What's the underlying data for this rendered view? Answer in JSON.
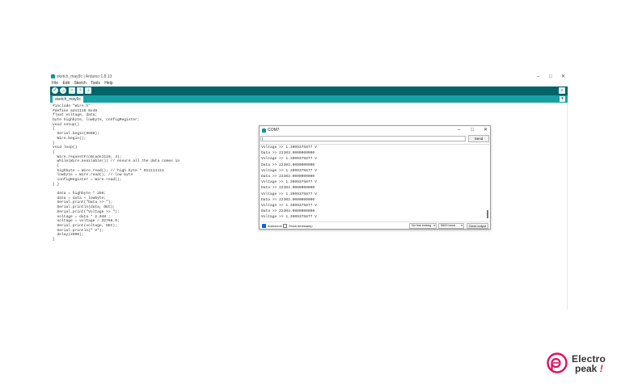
{
  "ide": {
    "title": "sketch_may9c | Arduino 1.8.13",
    "window_controls": [
      "–",
      "□",
      "✕"
    ],
    "menu": [
      "File",
      "Edit",
      "Sketch",
      "Tools",
      "Help"
    ],
    "toolbar_icons": [
      "verify-icon",
      "upload-icon",
      "new-icon",
      "open-icon",
      "save-icon"
    ],
    "tab_label": "sketch_may9c",
    "code_lines": [
      "#include \"Wire.h\"",
      "#define ads1110 0x48",
      "float voltage, data;",
      "byte highbyte, lowbyte, configRegister;",
      "void setup()",
      "{",
      "  Serial.begin(9600);",
      "  Wire.begin();",
      "}",
      "void loop()",
      "{",
      "  Wire.requestFrom(ads1110, 3);",
      "  while(Wire.available()) // ensure all the data comes in",
      "  {",
      "  highbyte = Wire.read(); // high byte * B11111111",
      "  lowbyte = Wire.read(); // low byte",
      "  configRegister = Wire.read();",
      "} }",
      "",
      "  data = highbyte * 256;",
      "  data = data + lowbyte;",
      "  Serial.print(\"Data >> \");",
      "  Serial.println(data, DEC);",
      "  Serial.print(\"Voltage >> \");",
      "  voltage = data * 2.048 ;",
      "  voltage = voltage / 32768.0;",
      "  Serial.print(voltage, DEC);",
      "  Serial.println(\" V\");",
      "  delay(2000);",
      "}"
    ]
  },
  "serial_monitor": {
    "title": "COM7",
    "window_controls": [
      "–",
      "□",
      "✕"
    ],
    "input_value": "|",
    "send_label": "Send",
    "output_lines": [
      "Voltage >> 1.3909375877 V",
      "Data >> 22303.0000000000",
      "Voltage >> 1.3909375877 V",
      "Data >> 22303.0000000000",
      "Voltage >> 1.3909375877 V",
      "Data >> 22303.0000000000",
      "Voltage >> 1.3909375877 V",
      "Data >> 22303.0000000000",
      "Voltage >> 1.3909375877 V",
      "Data >> 22303.0000000000",
      "Voltage >> 1.3909375877 V",
      "Data >> 22303.0000000000",
      "Voltage >> 1.3909375877 V"
    ],
    "autoscroll_label": "Autoscroll",
    "autoscroll_checked": true,
    "timestamp_label": "Show timestamp",
    "timestamp_checked": false,
    "line_ending": "No line ending",
    "baud": "9600 baud",
    "clear_label": "Clear output"
  },
  "logo": {
    "line1": "Electro",
    "line2": "peak",
    "bang": "!"
  },
  "colors": {
    "toolbar": "#006468",
    "tabbar": "#17a1a5",
    "accent": "#e0115f"
  }
}
